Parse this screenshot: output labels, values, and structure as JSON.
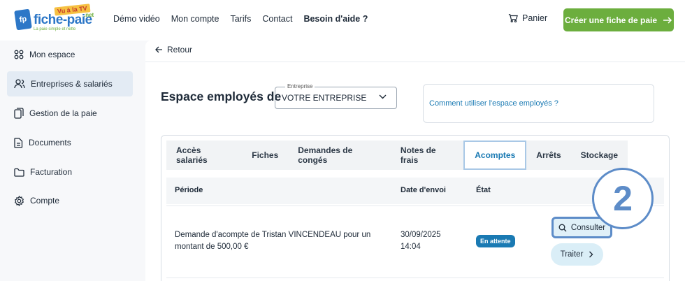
{
  "logo": {
    "badge": "fp",
    "name": "fiche-paie",
    "net": ".net",
    "tv": "Vu à la TV",
    "tagline": "La paie simple et nette"
  },
  "nav": {
    "items": [
      "Démo vidéo",
      "Mon compte",
      "Tarifs",
      "Contact"
    ],
    "help": "Besoin d'aide ?"
  },
  "header": {
    "cart_label": "Panier",
    "cta_label": "Créer une fiche de paie"
  },
  "sidebar": {
    "items": [
      {
        "label": "Mon espace",
        "icon": "grid-icon"
      },
      {
        "label": "Entreprises & salariés",
        "icon": "users-icon"
      },
      {
        "label": "Gestion de la paie",
        "icon": "files-icon"
      },
      {
        "label": "Documents",
        "icon": "document-icon"
      },
      {
        "label": "Facturation",
        "icon": "folder-icon"
      },
      {
        "label": "Compte",
        "icon": "gear-icon"
      }
    ]
  },
  "main": {
    "back_label": "Retour",
    "title": "Espace employés de",
    "select": {
      "label": "Entreprise",
      "value": "VOTRE ENTREPRISE"
    },
    "help_link": "Comment utiliser l'espace employés ?",
    "tabs": [
      "Accès salariés",
      "Fiches",
      "Demandes de congés",
      "Notes de frais",
      "Acomptes",
      "Arrêts",
      "Stockage"
    ],
    "active_tab": "Acomptes",
    "table": {
      "headers": {
        "period": "Période",
        "date": "Date d'envoi",
        "state": "État"
      },
      "rows": [
        {
          "description": "Demande d'acompte de Tristan VINCENDEAU pour un montant de 500,00 €",
          "date_line1": "30/09/2025",
          "date_line2": "14:04",
          "status": "En attente",
          "consult_label": "Consulter",
          "treat_label": "Traiter"
        }
      ]
    }
  },
  "step_marker": "2",
  "colors": {
    "accent": "#1a7ab3",
    "cta": "#6cae3e",
    "highlight": "#5d8cc8"
  }
}
